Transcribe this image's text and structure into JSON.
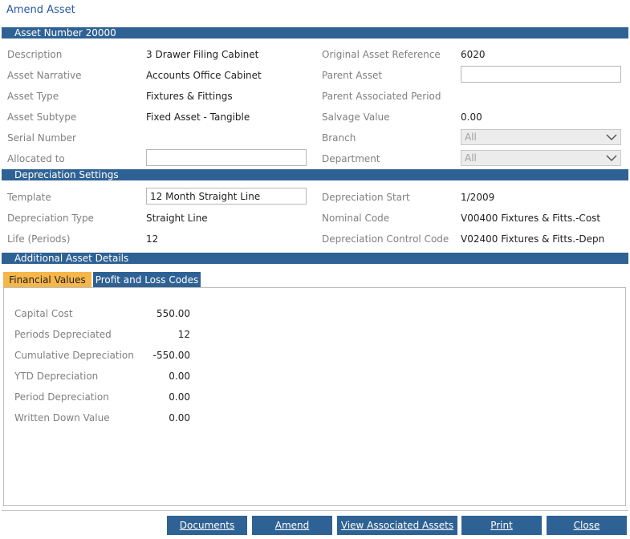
{
  "title": "Amend Asset",
  "sections": {
    "asset": "Asset Number 20000",
    "depreciation": "Depreciation Settings",
    "additional": "Additional Asset Details"
  },
  "asset": {
    "description_label": "Description",
    "description": "3 Drawer Filing Cabinet",
    "narrative_label": "Asset Narrative",
    "narrative": "Accounts Office Cabinet",
    "type_label": "Asset Type",
    "type": "Fixtures & Fittings",
    "subtype_label": "Asset Subtype",
    "subtype": "Fixed Asset - Tangible",
    "serial_label": "Serial Number",
    "serial": "",
    "allocated_label": "Allocated to",
    "allocated": "",
    "orig_ref_label": "Original Asset Reference",
    "orig_ref": "6020",
    "parent_label": "Parent Asset",
    "parent": "",
    "parent_period_label": "Parent Associated Period",
    "parent_period": "",
    "salvage_label": "Salvage Value",
    "salvage": "0.00",
    "branch_label": "Branch",
    "branch": "All",
    "department_label": "Department",
    "department": "All"
  },
  "depreciation": {
    "template_label": "Template",
    "template": "12 Month Straight Line",
    "type_label": "Depreciation Type",
    "type": "Straight Line",
    "life_label": "Life (Periods)",
    "life": "12",
    "start_label": "Depreciation Start",
    "start": "1/2009",
    "nominal_label": "Nominal Code",
    "nominal": "V00400 Fixtures & Fitts.-Cost",
    "control_label": "Depreciation Control Code",
    "control": "V02400 Fixtures & Fitts.-Depn"
  },
  "tabs": {
    "financial": "Financial Values",
    "pl": "Profit and Loss Codes"
  },
  "financial": [
    {
      "label": "Capital Cost",
      "value": "550.00"
    },
    {
      "label": "Periods Depreciated",
      "value": "12"
    },
    {
      "label": "Cumulative Depreciation",
      "value": "-550.00"
    },
    {
      "label": "YTD Depreciation",
      "value": "0.00"
    },
    {
      "label": "Period Depreciation",
      "value": "0.00"
    },
    {
      "label": "Written Down Value",
      "value": "0.00"
    }
  ],
  "buttons": {
    "documents": "Documents",
    "amend": "Amend",
    "view_assoc": "View Associated Assets",
    "print": "Print",
    "close": "Close"
  },
  "colors": {
    "section_bar": "#2f6294",
    "active_tab": "#f5b64a",
    "title": "#2a5aa3"
  },
  "icons": {
    "dropdown": "chevron-down-icon"
  }
}
